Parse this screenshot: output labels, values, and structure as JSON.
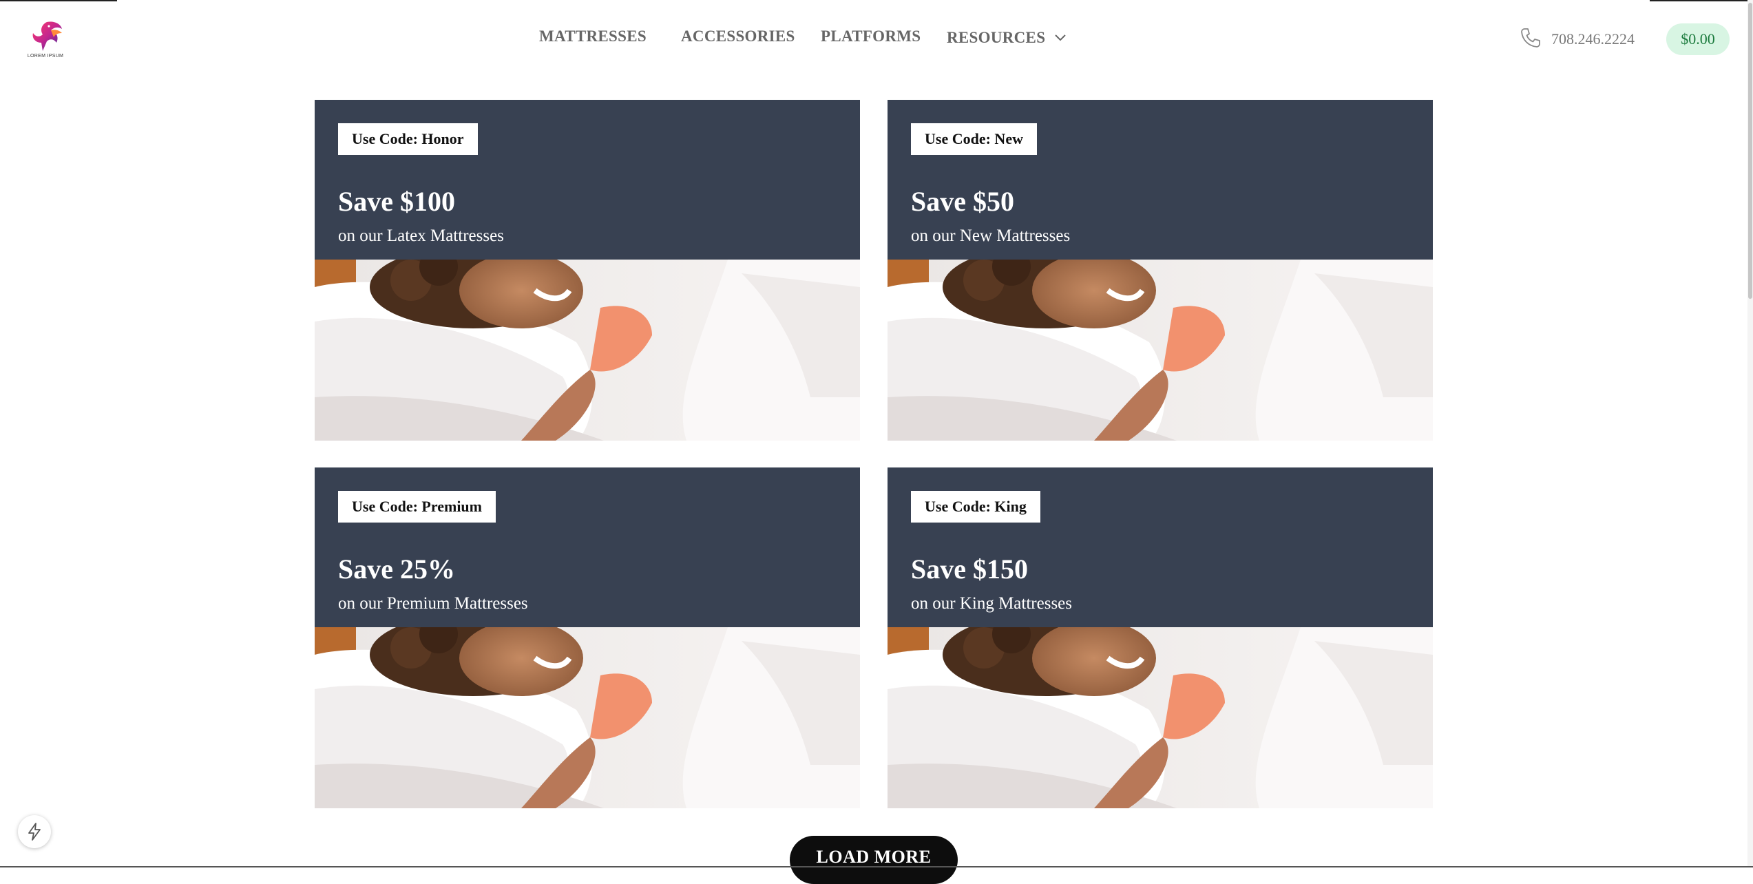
{
  "header": {
    "logo_text": "LOREM IPSUM",
    "nav": [
      {
        "label": "MATTRESSES"
      },
      {
        "label": "ACCESSORIES"
      },
      {
        "label": "PLATFORMS"
      },
      {
        "label": "RESOURCES",
        "has_dropdown": true
      }
    ],
    "phone": "708.246.2224",
    "cart_total": "$0.00"
  },
  "promos": [
    {
      "code": "Use Code: Honor",
      "title": "Save $100",
      "subtitle": "on our Latex Mattresses"
    },
    {
      "code": "Use Code: New",
      "title": "Save $50",
      "subtitle": "on our New Mattresses"
    },
    {
      "code": "Use Code: Premium",
      "title": "Save 25%",
      "subtitle": "on our Premium Mattresses"
    },
    {
      "code": "Use Code: King",
      "title": "Save $150",
      "subtitle": "on our King Mattresses"
    }
  ],
  "load_more_label": "LOAD MORE",
  "icons": {
    "phone": "phone-icon",
    "dropdown": "chevron-down-icon",
    "floating": "lightning-bolt-icon"
  },
  "colors": {
    "card_bg": "#384152",
    "cart_bg": "#d8f5e3",
    "cart_text": "#1a7a3c",
    "button_bg": "#0d0d0d"
  }
}
